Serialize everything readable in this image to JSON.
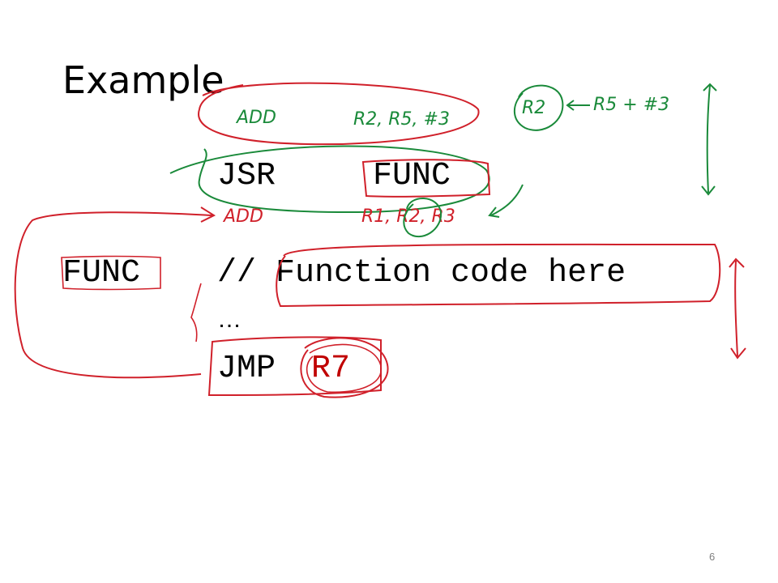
{
  "slide": {
    "title": "Example",
    "page_number": "6"
  },
  "code": {
    "line1_instr": "JSR",
    "line1_operand": "FUNC",
    "line2_label": "FUNC",
    "line2_comment": "// Function code here",
    "line3_ellipsis": "…",
    "line4_instr": "JMP",
    "line4_operand": "R7"
  },
  "annotations": {
    "add_top": "ADD",
    "add_top_args": "R2, R5, #3",
    "r2_circled": "R2",
    "r5_plus_3": "R5 + #3",
    "add_bottom": "ADD",
    "add_bottom_args": "R1, R2, R3"
  },
  "colors": {
    "ink_red": "#d0202a",
    "ink_green": "#1a8a3a",
    "text": "#000000",
    "page_number": "#7f7f7f"
  }
}
